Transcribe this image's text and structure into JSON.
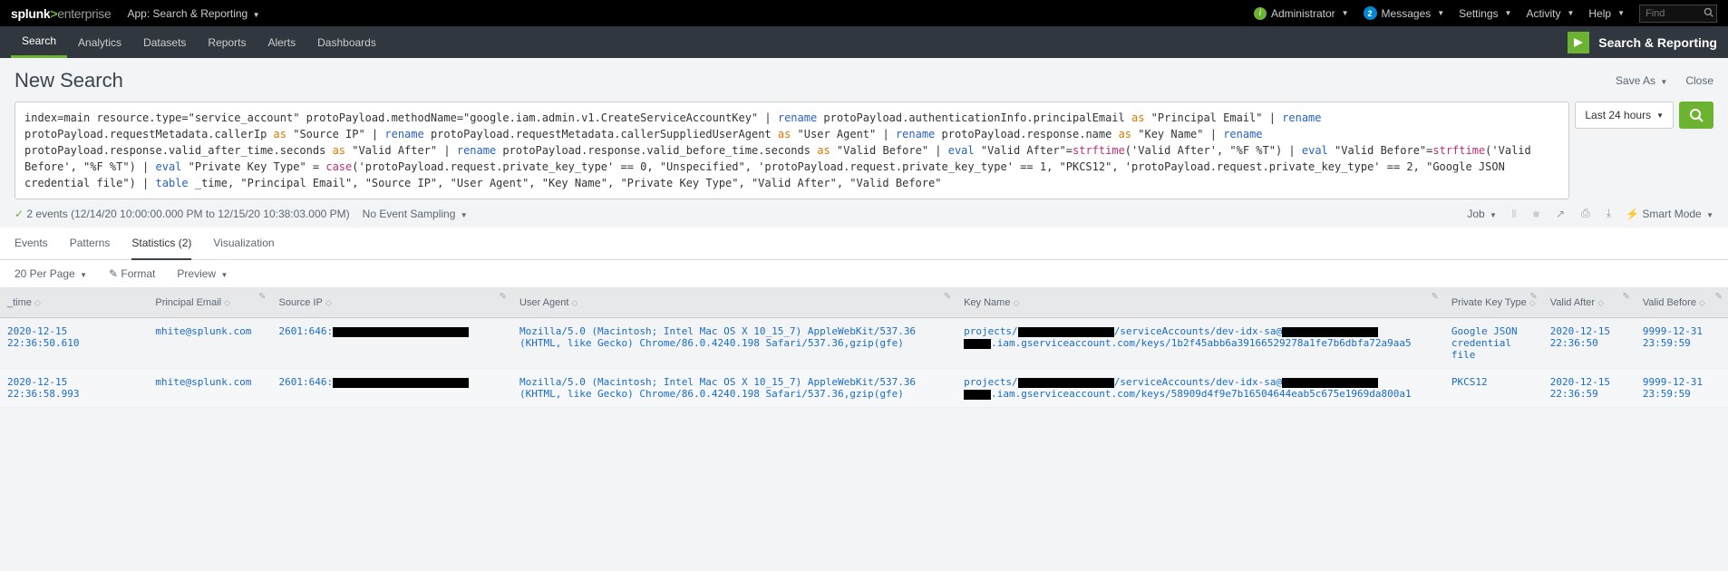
{
  "topbar": {
    "app_label": "App: Search & Reporting",
    "admin": "Administrator",
    "messages": "Messages",
    "messages_count": "2",
    "settings": "Settings",
    "activity": "Activity",
    "help": "Help",
    "find_placeholder": "Find"
  },
  "nav": {
    "items": [
      "Search",
      "Analytics",
      "Datasets",
      "Reports",
      "Alerts",
      "Dashboards"
    ],
    "sr_label": "Search & Reporting"
  },
  "header": {
    "title": "New Search",
    "save_as": "Save As",
    "close": "Close"
  },
  "timerange": "Last 24 hours",
  "spl": {
    "seg01": "index=main resource.type=\"service_account\" protoPayload.methodName=\"google.iam.admin.v1.CreateServiceAccountKey\" | ",
    "rn1": "rename",
    "seg02": " protoPayload.authenticationInfo.principalEmail ",
    "as1": "as",
    "seg03": " \"Principal Email\" | ",
    "rn2": "rename",
    "seg04": " protoPayload.requestMetadata.callerIp ",
    "as2": "as",
    "seg05": " \"Source IP\" | ",
    "rn3": "rename",
    "seg06": " protoPayload.requestMetadata.callerSuppliedUserAgent ",
    "as3": "as",
    "seg07": " \"User Agent\" | ",
    "rn4": "rename",
    "seg08": " protoPayload.response.name ",
    "as4": "as",
    "seg09": " \"Key Name\" | ",
    "rn5": "rename",
    "seg10": " protoPayload.response.valid_after_time.seconds ",
    "as5": "as",
    "seg11": " \"Valid After\" | ",
    "rn6": "rename",
    "seg12": " protoPayload.response.valid_before_time.seconds ",
    "as6": "as",
    "seg13": " \"Valid Before\" | ",
    "ev1": "eval",
    "seg14": " \"Valid After\"=",
    "fn1": "strftime",
    "seg15": "('Valid After', \"%F %T\") | ",
    "ev2": "eval",
    "seg16": " \"Valid Before\"=",
    "fn2": "strftime",
    "seg17": "('Valid Before', \"%F %T\") | ",
    "ev3": "eval",
    "seg18": " \"Private Key Type\" = ",
    "fn3": "case",
    "seg19": "('protoPayload.request.private_key_type' == 0, \"Unspecified\", 'protoPayload.request.private_key_type' == 1, \"PKCS12\", 'protoPayload.request.private_key_type' == 2, \"Google JSON credential file\") | ",
    "tbl": "table",
    "seg20": " _time, \"Principal Email\", \"Source IP\", \"User Agent\", \"Key Name\", \"Private Key Type\", \"Valid After\", \"Valid Before\""
  },
  "status": {
    "events": "2 events (12/14/20 10:00:00.000 PM to 12/15/20 10:38:03.000 PM)",
    "sampling": "No Event Sampling",
    "job": "Job",
    "smart": "Smart Mode"
  },
  "tabs": {
    "events": "Events",
    "patterns": "Patterns",
    "stats": "Statistics (2)",
    "viz": "Visualization"
  },
  "toolbar": {
    "perpage": "20 Per Page",
    "format": "Format",
    "preview": "Preview"
  },
  "cols": {
    "time": "_time",
    "pemail": "Principal Email",
    "sip": "Source IP",
    "ua": "User Agent",
    "kname": "Key Name",
    "ktype": "Private Key Type",
    "va": "Valid After",
    "vb": "Valid Before"
  },
  "rows": [
    {
      "time": "2020-12-15 22:36:50.610",
      "pemail": "mhite@splunk.com",
      "sip_prefix": "2601:646:",
      "ua": "Mozilla/5.0 (Macintosh; Intel Mac OS X 10_15_7) AppleWebKit/537.36 (KHTML, like Gecko) Chrome/86.0.4240.198 Safari/537.36,gzip(gfe)",
      "kn_a": "projects/",
      "kn_b": "/serviceAccounts/dev-idx-sa@",
      "kn_c": ".iam.gserviceaccount.com/keys/1b2f45abb6a39166529278a1fe7b6dbfa72a9aa5",
      "ktype": "Google JSON credential file",
      "va": "2020-12-15 22:36:50",
      "vb": "9999-12-31 23:59:59"
    },
    {
      "time": "2020-12-15 22:36:58.993",
      "pemail": "mhite@splunk.com",
      "sip_prefix": "2601:646:",
      "ua": "Mozilla/5.0 (Macintosh; Intel Mac OS X 10_15_7) AppleWebKit/537.36 (KHTML, like Gecko) Chrome/86.0.4240.198 Safari/537.36,gzip(gfe)",
      "kn_a": "projects/",
      "kn_b": "/serviceAccounts/dev-idx-sa@",
      "kn_c": ".iam.gserviceaccount.com/keys/58909d4f9e7b16504644eab5c675e1969da800a1",
      "ktype": "PKCS12",
      "va": "2020-12-15 22:36:59",
      "vb": "9999-12-31 23:59:59"
    }
  ]
}
